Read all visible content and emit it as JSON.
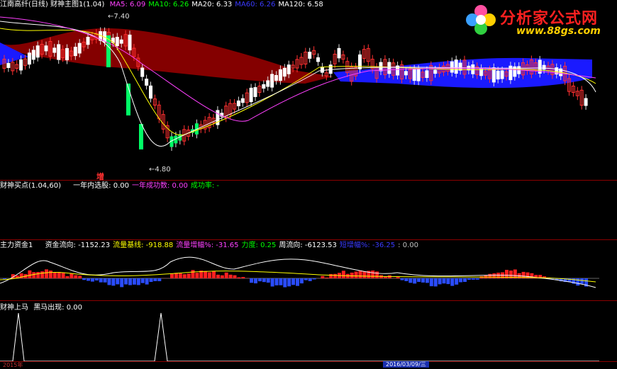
{
  "panel1": {
    "title": "江南高纤(日线) 财神主图1(1.04)",
    "ma": [
      {
        "label": "MA5: 6.09",
        "color": "#ff40ff"
      },
      {
        "label": "MA10: 6.26",
        "color": "#00ff00"
      },
      {
        "label": "MA20: 6.33",
        "color": "#ffffff"
      },
      {
        "label": "MA60: 6.26",
        "color": "#3a3aff"
      },
      {
        "label": "MA120: 6.58",
        "color": "#ffffff"
      }
    ],
    "high_label": "7.40",
    "low_label": "4.80",
    "marker": "增"
  },
  "panel2": {
    "title": "财神买点(1.04,60)",
    "items": [
      {
        "text": "一年内选股: 0.00",
        "color": "#ffffff"
      },
      {
        "text": "一年成功数: 0.00",
        "color": "#ff40ff"
      },
      {
        "text": "成功率: -",
        "color": "#00ff00"
      }
    ]
  },
  "panel3": {
    "title": "主力资金1",
    "items": [
      {
        "text": "资金流向: -1152.23",
        "color": "#ffffff"
      },
      {
        "text": "流量基线: -918.88",
        "color": "#ffff00"
      },
      {
        "text": "流量增幅%: -31.65",
        "color": "#ff40ff"
      },
      {
        "text": "力度: 0.25",
        "color": "#00ff00"
      },
      {
        "text": "周流向: -6123.53",
        "color": "#ffffff"
      },
      {
        "text": "短增幅%: -36.25",
        "color": "#3a3aff"
      },
      {
        "text": ": 0.00",
        "color": "#c0c0c0"
      }
    ]
  },
  "panel4": {
    "title": "财神上马",
    "items": [
      {
        "text": "黑马出现: 0.00",
        "color": "#ffffff"
      }
    ]
  },
  "logo": {
    "name": "分析家公式网",
    "url": "www.88gs.com"
  },
  "xaxis": {
    "start": "2015年",
    "date_tag": "2016/03/09/三"
  },
  "colors": {
    "up": "#ff3030",
    "down": "#00ff66",
    "cloud_red": "#8b0000",
    "cloud_blue": "#1a1aff",
    "border": "#8b0000"
  }
}
